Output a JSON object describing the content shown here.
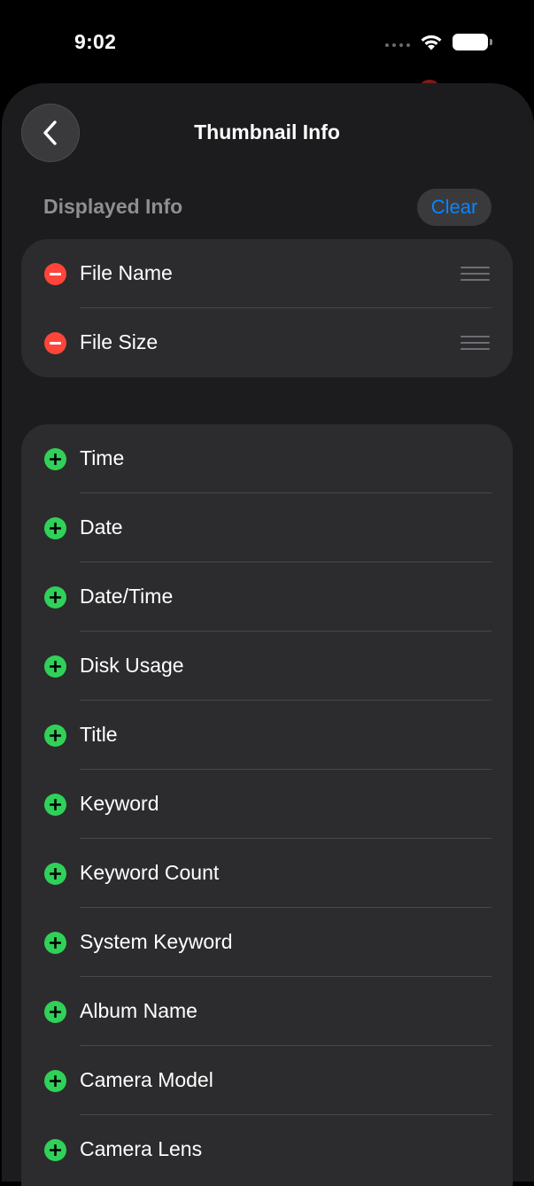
{
  "status_bar": {
    "time": "9:02"
  },
  "nav": {
    "title": "Thumbnail Info",
    "back_icon": "chevron-left-icon"
  },
  "displayed_section": {
    "header": "Displayed Info",
    "clear_label": "Clear",
    "items": [
      {
        "label": "File Name"
      },
      {
        "label": "File Size"
      }
    ]
  },
  "available_section": {
    "items": [
      {
        "label": "Time"
      },
      {
        "label": "Date"
      },
      {
        "label": "Date/Time"
      },
      {
        "label": "Disk Usage"
      },
      {
        "label": "Title"
      },
      {
        "label": "Keyword"
      },
      {
        "label": "Keyword Count"
      },
      {
        "label": "System Keyword"
      },
      {
        "label": "Album Name"
      },
      {
        "label": "Camera Model"
      },
      {
        "label": "Camera Lens"
      }
    ]
  },
  "colors": {
    "background": "#000000",
    "sheet": "#1c1c1e",
    "group": "#2c2c2e",
    "accent": "#0a84ff",
    "remove": "#ff453a",
    "add": "#30d158"
  }
}
